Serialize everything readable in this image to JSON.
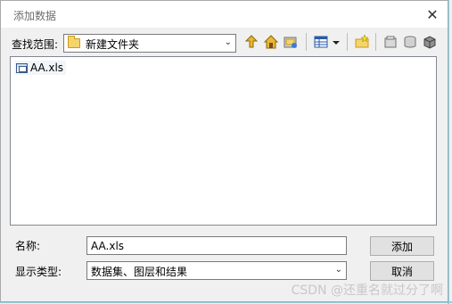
{
  "window": {
    "title": "添加数据",
    "close_icon": "close-icon"
  },
  "lookin": {
    "label": "查找范围:",
    "value": "新建文件夹"
  },
  "toolbar": {
    "icons": [
      "up-folder-icon",
      "home-icon",
      "connect-folder-icon",
      "view-list-icon",
      "view-dropdown-icon",
      "new-folder-icon",
      "catalog-icon",
      "database-icon",
      "server-icon"
    ]
  },
  "files": [
    {
      "name": "AA.xls",
      "icon": "xls-table-icon"
    }
  ],
  "name_field": {
    "label": "名称:",
    "value": "AA.xls"
  },
  "type_field": {
    "label": "显示类型:",
    "value": "数据集、图层和结果"
  },
  "buttons": {
    "add": "添加",
    "cancel": "取消"
  },
  "watermark": "CSDN @还重名就过分了啊"
}
